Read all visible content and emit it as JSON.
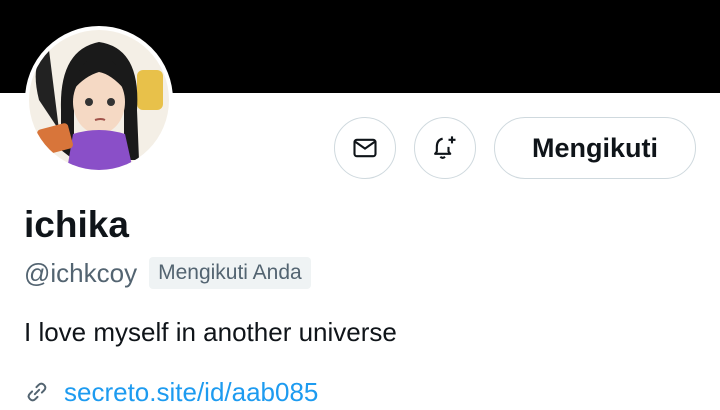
{
  "profile": {
    "display_name": "ichika",
    "handle": "@ichkcoy",
    "follows_you": "Mengikuti Anda",
    "bio": "I love myself in another universe",
    "website": "secreto.site/id/aab085"
  },
  "actions": {
    "message_icon": "envelope-icon",
    "notify_icon": "bell-plus-icon",
    "follow_label": "Mengikuti"
  },
  "colors": {
    "banner": "#000000",
    "text": "#0f1419",
    "secondary_text": "#536471",
    "link": "#1d9bf0",
    "border": "#cfd9de"
  }
}
